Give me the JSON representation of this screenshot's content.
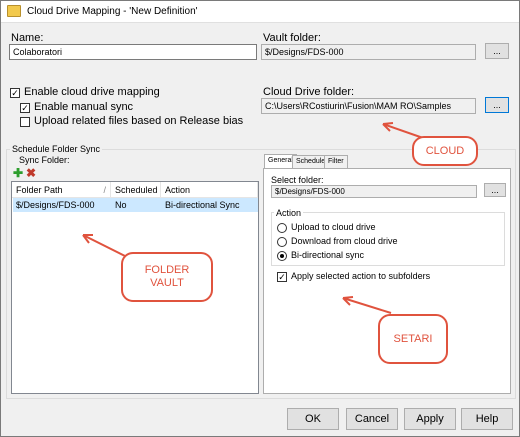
{
  "window": {
    "title": "Cloud Drive Mapping - 'New Definition'"
  },
  "name": {
    "label": "Name:",
    "value": "Colaboratori"
  },
  "vault_folder": {
    "label": "Vault folder:",
    "value": "$/Designs/FDS-000",
    "browse": "..."
  },
  "options": {
    "enable_cloud": "Enable cloud drive mapping",
    "enable_manual": "Enable manual sync",
    "upload_related": "Upload related files based on Release bias"
  },
  "cloud_folder": {
    "label": "Cloud Drive folder:",
    "value": "C:\\Users\\RCostiurin\\Fusion\\MAM RO\\Samples",
    "browse": "..."
  },
  "schedule": {
    "group_title": "Schedule Folder Sync",
    "sync_folder_label": "Sync Folder:",
    "columns": [
      "Folder Path",
      "Scheduled",
      "Action"
    ],
    "rows": [
      {
        "path": "$/Designs/FDS-000",
        "scheduled": "No",
        "action": "Bi-directional Sync"
      }
    ]
  },
  "tabs": {
    "items": [
      "General",
      "Schedule",
      "Filter"
    ]
  },
  "general": {
    "select_folder_label": "Select folder:",
    "select_folder_value": "$/Designs/FDS-000",
    "browse": "...",
    "action_title": "Action",
    "radios": [
      "Upload to cloud drive",
      "Download from cloud drive",
      "Bi-directional sync"
    ],
    "apply_sub": "Apply selected action to subfolders"
  },
  "callouts": {
    "cloud": "CLOUD",
    "folder_vault": "FOLDER VAULT",
    "setari": "SETARI"
  },
  "footer": {
    "ok": "OK",
    "cancel": "Cancel",
    "apply": "Apply",
    "help": "Help"
  },
  "colors": {
    "accent": "#0078d7",
    "callout": "#e0533e",
    "selection": "#cce8ff"
  },
  "icons": {
    "add": "plus-icon",
    "delete": "x-icon",
    "check": "checkmark"
  }
}
